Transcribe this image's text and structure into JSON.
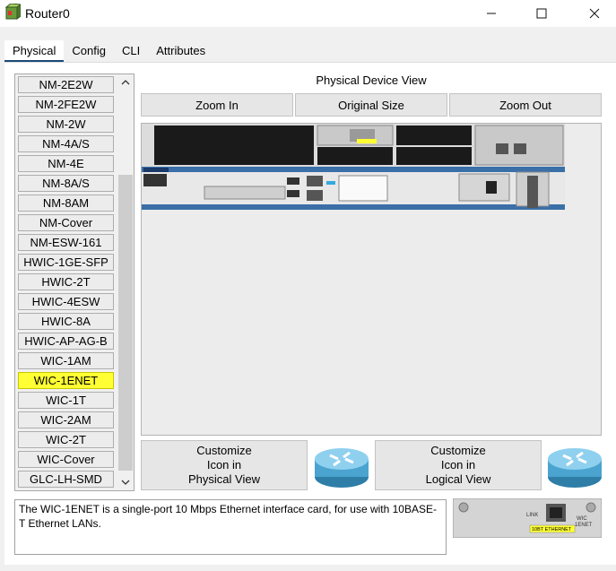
{
  "window": {
    "title": "Router0",
    "minimize": "—",
    "maximize": "☐",
    "close": "✕"
  },
  "tabs": [
    {
      "label": "Physical",
      "active": true
    },
    {
      "label": "Config"
    },
    {
      "label": "CLI"
    },
    {
      "label": "Attributes"
    }
  ],
  "modules": {
    "items": [
      "NM-2E2W",
      "NM-2FE2W",
      "NM-2W",
      "NM-4A/S",
      "NM-4E",
      "NM-8A/S",
      "NM-8AM",
      "NM-Cover",
      "NM-ESW-161",
      "HWIC-1GE-SFP",
      "HWIC-2T",
      "HWIC-4ESW",
      "HWIC-8A",
      "HWIC-AP-AG-B",
      "WIC-1AM",
      "WIC-1ENET",
      "WIC-1T",
      "WIC-2AM",
      "WIC-2T",
      "WIC-Cover",
      "GLC-LH-SMD"
    ],
    "selected": "WIC-1ENET",
    "scroll_up": "⌃",
    "scroll_down": "⌄"
  },
  "physical_view": {
    "title": "Physical Device View",
    "zoom_in": "Zoom In",
    "original_size": "Original Size",
    "zoom_out": "Zoom Out"
  },
  "customize": {
    "physical": "Customize\nIcon in\nPhysical View",
    "logical": "Customize\nIcon in\nLogical View"
  },
  "description": "The WIC-1ENET is a single-port 10 Mbps Ethernet interface card, for use with 10BASE-T Ethernet LANs.",
  "module_preview": {
    "link_label": "LINK",
    "card_label": "WIC\n1ENET",
    "port_label": "10BT ETHERNET"
  },
  "colors": {
    "selected_item": "#ffff33",
    "tab_underline": "#1a4a7a",
    "router_blue": "#3a6fa8"
  }
}
